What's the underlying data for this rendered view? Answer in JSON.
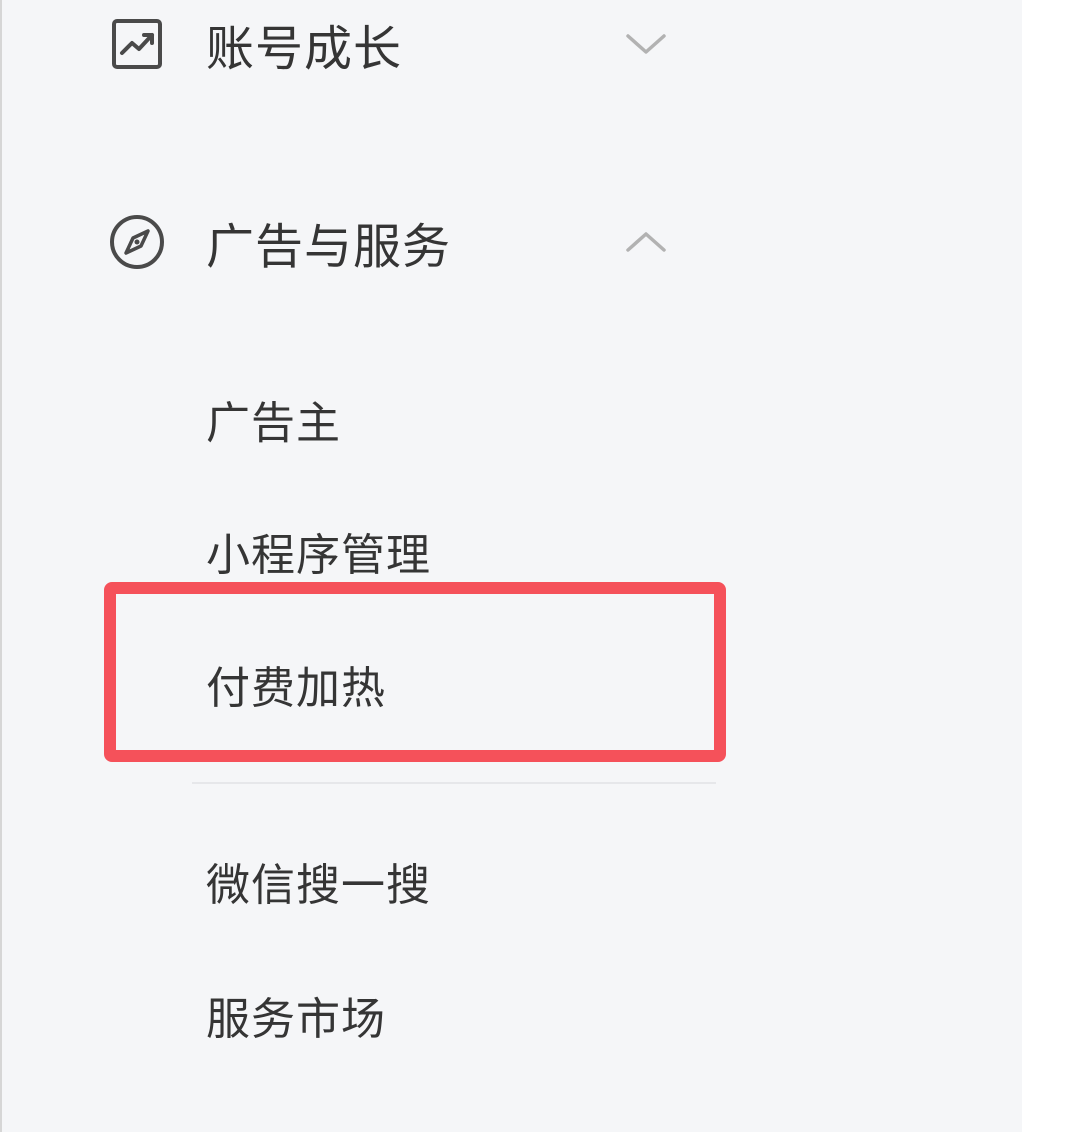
{
  "sidebar": {
    "groups": [
      {
        "label": "账号成长",
        "icon": "trend-chart-icon",
        "state": "collapsed"
      },
      {
        "label": "广告与服务",
        "icon": "compass-icon",
        "state": "expanded",
        "items": [
          {
            "label": "广告主"
          },
          {
            "label": "小程序管理"
          },
          {
            "label": "付费加热",
            "highlighted": true
          },
          {
            "label": "微信搜一搜"
          },
          {
            "label": "服务市场"
          }
        ]
      }
    ]
  },
  "colors": {
    "sidebar_bg": "#f5f6f8",
    "text": "#353535",
    "icon": "#4a4a4a",
    "chevron": "#b2b2b2",
    "highlight": "#f5515a"
  }
}
